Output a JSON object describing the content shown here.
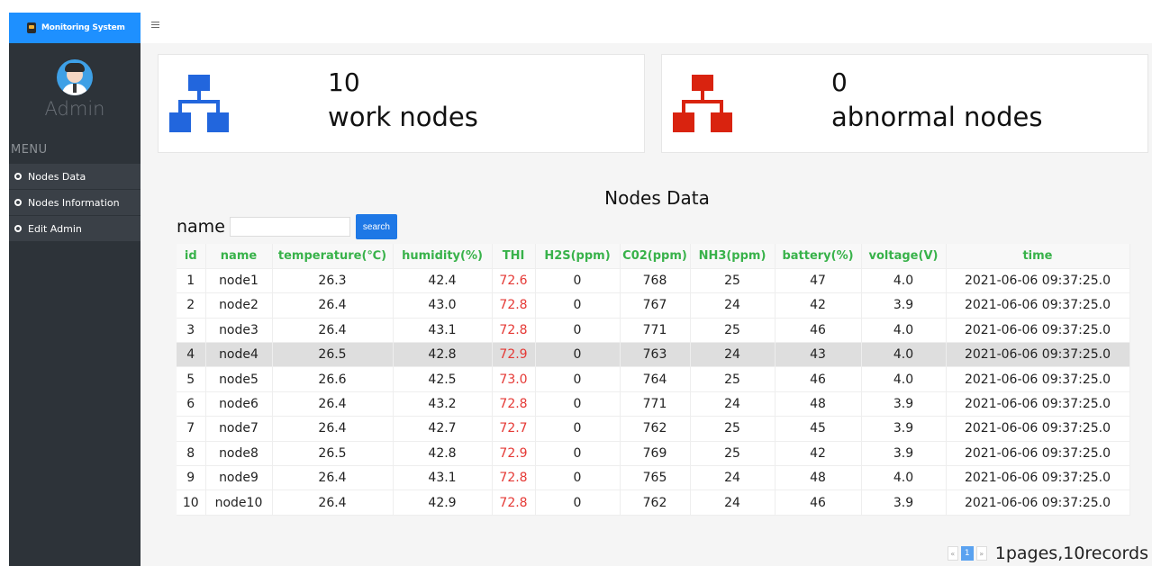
{
  "brand": {
    "title": "Monitoring System"
  },
  "sidebar": {
    "user_name": "Admin",
    "menu_label": "MENU",
    "items": [
      {
        "label": "Nodes Data"
      },
      {
        "label": "Nodes Information"
      },
      {
        "label": "Edit Admin"
      }
    ]
  },
  "cards": {
    "work": {
      "count": "10",
      "label": "work nodes",
      "color": "#2266dd"
    },
    "abnormal": {
      "count": "0",
      "label": "abnormal nodes",
      "color": "#d9230f"
    }
  },
  "section_title": "Nodes Data",
  "search": {
    "label": "name",
    "placeholder": "",
    "button": "search"
  },
  "table": {
    "columns": [
      "id",
      "name",
      "temperature(℃)",
      "humidity(%)",
      "THI",
      "H2S(ppm)",
      "C02(ppm)",
      "NH3(ppm)",
      "battery(%)",
      "voltage(V)",
      "time"
    ],
    "highlighted_row": 3,
    "rows": [
      [
        "1",
        "node1",
        "26.3",
        "42.4",
        "72.6",
        "0",
        "768",
        "25",
        "47",
        "4.0",
        "2021-06-06 09:37:25.0"
      ],
      [
        "2",
        "node2",
        "26.4",
        "43.0",
        "72.8",
        "0",
        "767",
        "24",
        "42",
        "3.9",
        "2021-06-06 09:37:25.0"
      ],
      [
        "3",
        "node3",
        "26.4",
        "43.1",
        "72.8",
        "0",
        "771",
        "25",
        "46",
        "4.0",
        "2021-06-06 09:37:25.0"
      ],
      [
        "4",
        "node4",
        "26.5",
        "42.8",
        "72.9",
        "0",
        "763",
        "24",
        "43",
        "4.0",
        "2021-06-06 09:37:25.0"
      ],
      [
        "5",
        "node5",
        "26.6",
        "42.5",
        "73.0",
        "0",
        "764",
        "25",
        "46",
        "4.0",
        "2021-06-06 09:37:25.0"
      ],
      [
        "6",
        "node6",
        "26.4",
        "43.2",
        "72.8",
        "0",
        "771",
        "24",
        "48",
        "3.9",
        "2021-06-06 09:37:25.0"
      ],
      [
        "7",
        "node7",
        "26.4",
        "42.7",
        "72.7",
        "0",
        "762",
        "25",
        "45",
        "3.9",
        "2021-06-06 09:37:25.0"
      ],
      [
        "8",
        "node8",
        "26.5",
        "42.8",
        "72.9",
        "0",
        "769",
        "25",
        "42",
        "3.9",
        "2021-06-06 09:37:25.0"
      ],
      [
        "9",
        "node9",
        "26.4",
        "43.1",
        "72.8",
        "0",
        "765",
        "24",
        "48",
        "4.0",
        "2021-06-06 09:37:25.0"
      ],
      [
        "10",
        "node10",
        "26.4",
        "42.9",
        "72.8",
        "0",
        "762",
        "24",
        "46",
        "3.9",
        "2021-06-06 09:37:25.0"
      ]
    ]
  },
  "pagination": {
    "prev": "«",
    "current": "1",
    "next": "»",
    "summary": "1pages,10records"
  },
  "colors": {
    "accent": "#1e90ff",
    "header_text": "#38b24a",
    "thi_text": "#e53935",
    "sidebar_bg": "#2d3339"
  }
}
